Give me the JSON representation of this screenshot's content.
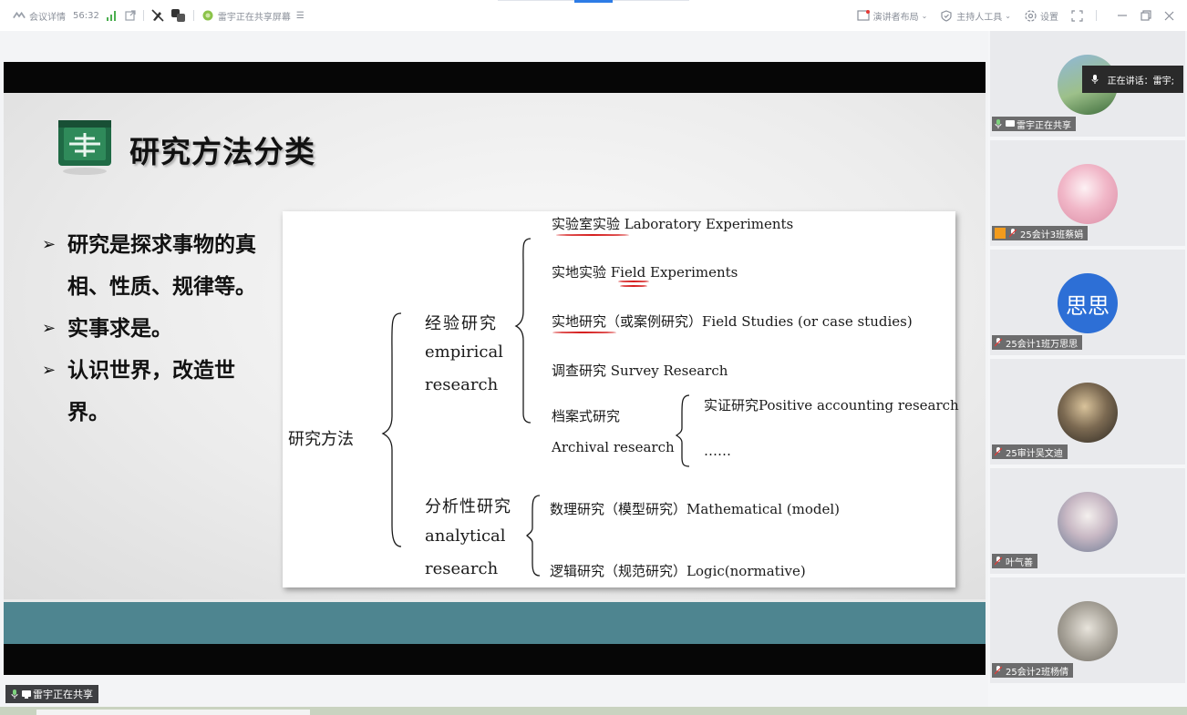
{
  "toolbar": {
    "meeting_details": "会议详情",
    "timer": "56:32",
    "sharing_status": "雷宇正在共享屏幕",
    "speaker_layout": "演讲者布局",
    "host_tools": "主持人工具",
    "settings": "设置"
  },
  "slide": {
    "title": "研究方法分类",
    "bullets": [
      "研究是探求事物的真相、性质、规律等。",
      "实事求是。",
      "认识世界，改造世界。"
    ],
    "bullet_marker": "➢",
    "diagram": {
      "root": "研究方法",
      "empirical_cn": "经验研究",
      "empirical_en1": "empirical",
      "empirical_en2": "research",
      "lab": "实验室实验 Laboratory Experiments",
      "field_exp": "实地实验 Field Experiments",
      "field_study": "实地研究（或案例研究）Field Studies (or case studies)",
      "survey": "调查研究 Survey Research",
      "archival_cn": "档案式研究",
      "archival_en": "Archival research",
      "positive": "实证研究Positive accounting research",
      "ellipsis": "……",
      "analytical_cn": "分析性研究",
      "analytical_en1": "analytical",
      "analytical_en2": "research",
      "math": "数理研究（模型研究）Mathematical (model)",
      "logic": "逻辑研究（规范研究）Logic(normative)"
    }
  },
  "share_tag": "雷宇正在共享",
  "participants": [
    {
      "name": "雷宇正在共享",
      "avatar": "photo-landscape"
    },
    {
      "name": "25会计3班蔡娟",
      "avatar": "photo-pink-doll",
      "host": true
    },
    {
      "name": "25会计1班万思思",
      "avatar_text": "思思"
    },
    {
      "name": "25审计吴文迪",
      "avatar": "photo-dim-room"
    },
    {
      "name": "叶气善",
      "avatar": "photo-person"
    },
    {
      "name": "25会计2班杨倩",
      "avatar": "photo-person-light"
    }
  ],
  "speaking": "正在讲话：雷宇;"
}
